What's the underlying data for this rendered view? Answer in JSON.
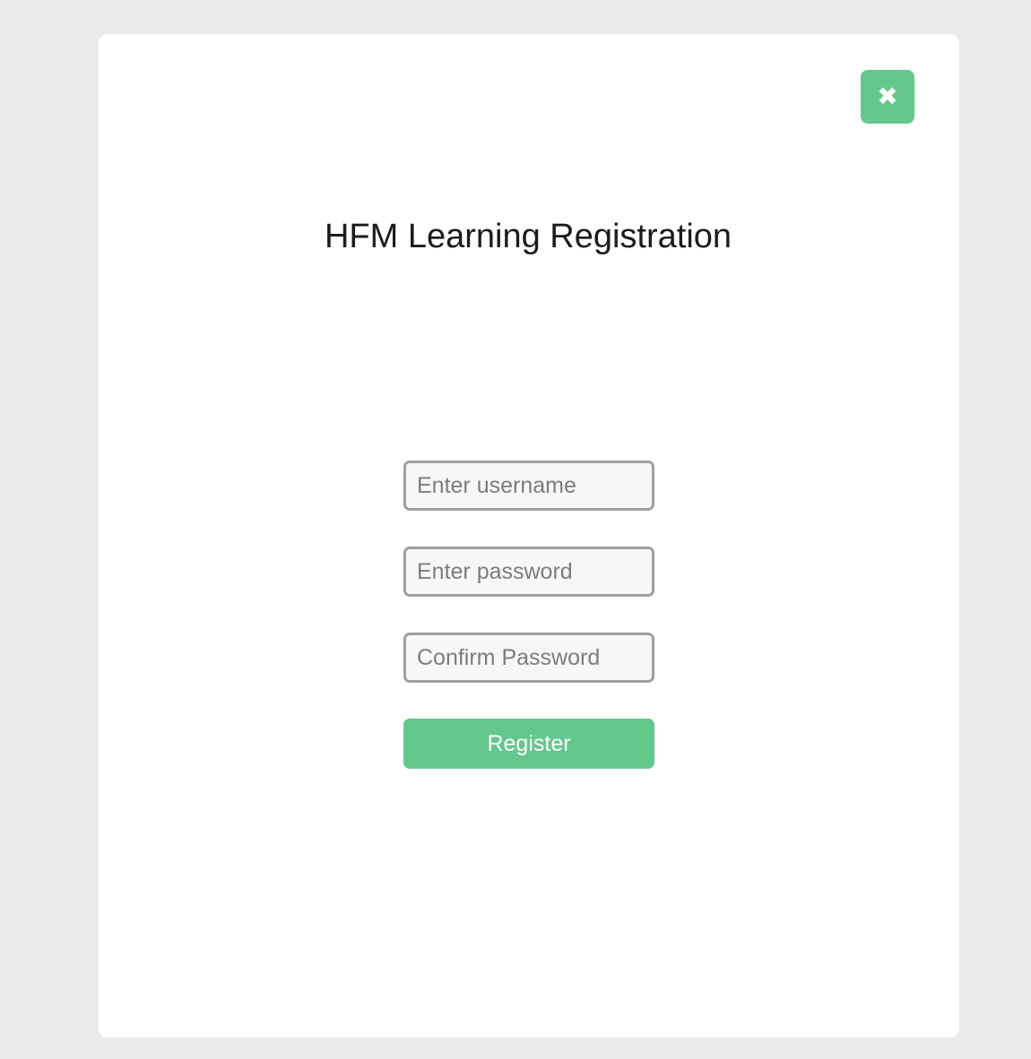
{
  "modal": {
    "close_label": "✖",
    "close_icon": "close-icon",
    "title": "HFM Learning Registration"
  },
  "form": {
    "username": {
      "value": "",
      "placeholder": "Enter username"
    },
    "password": {
      "value": "",
      "placeholder": "Enter password"
    },
    "confirm_password": {
      "value": "",
      "placeholder": "Confirm Password"
    },
    "register_label": "Register"
  },
  "colors": {
    "accent": "#64c88c",
    "page_background": "#eaeaea",
    "modal_background": "#ffffff",
    "input_border": "#9ba0a4",
    "input_background": "#f7f7f7",
    "title_text": "#1b1b1b"
  }
}
